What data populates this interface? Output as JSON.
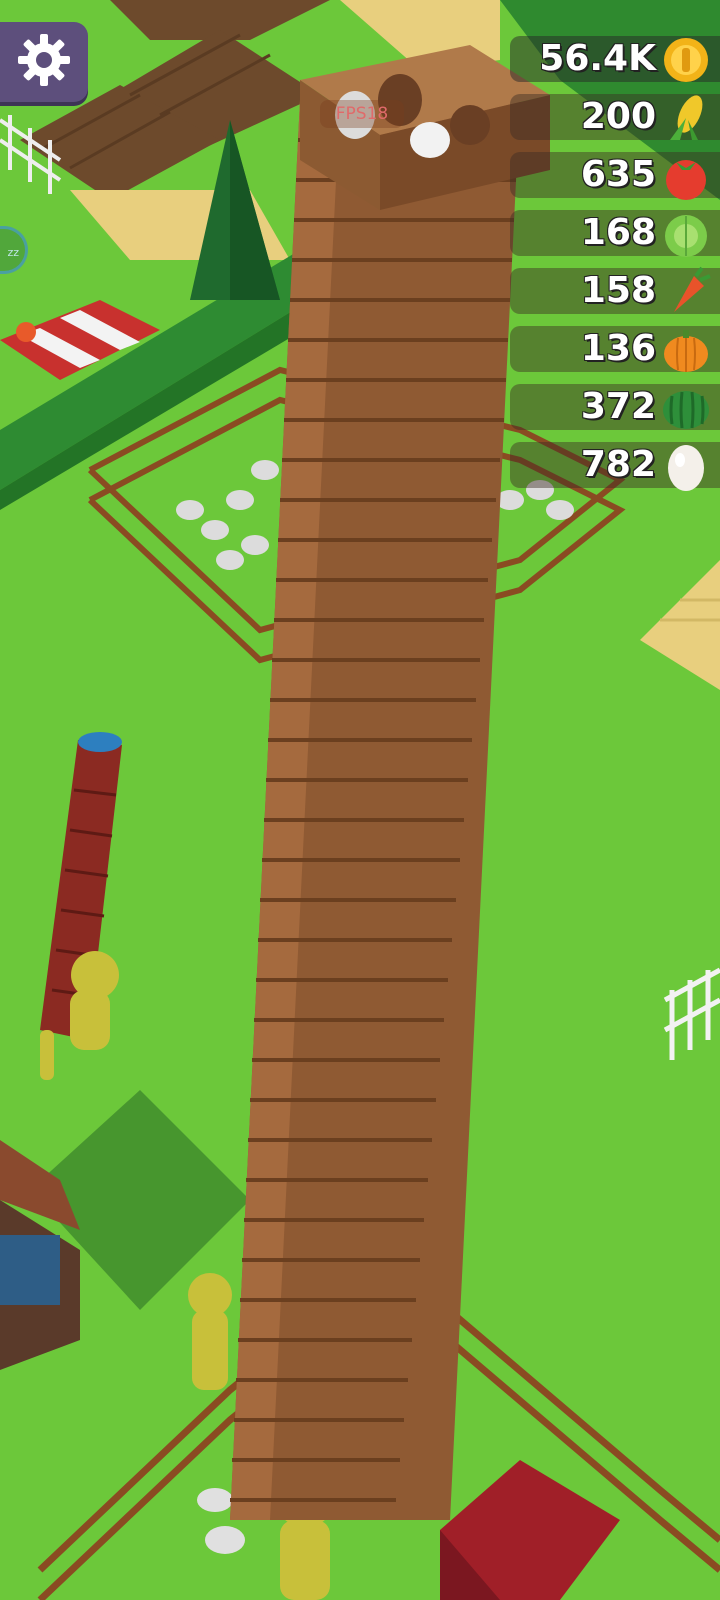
{
  "hud": {
    "fps": "FPS18",
    "side_badge": "zz"
  },
  "resources": [
    {
      "name": "coins",
      "value": "56.4K",
      "icon": "gold-coin-icon",
      "color": "#f2b318"
    },
    {
      "name": "corn",
      "value": "200",
      "icon": "corn-icon",
      "color": "#f0c82a"
    },
    {
      "name": "tomato",
      "value": "635",
      "icon": "tomato-icon",
      "color": "#e53c2e"
    },
    {
      "name": "cabbage",
      "value": "168",
      "icon": "cabbage-icon",
      "color": "#7ccc4a"
    },
    {
      "name": "carrot",
      "value": "158",
      "icon": "carrot-icon",
      "color": "#e8532a"
    },
    {
      "name": "pumpkin",
      "value": "136",
      "icon": "pumpkin-icon",
      "color": "#f08a1f"
    },
    {
      "name": "watermelon",
      "value": "372",
      "icon": "watermelon-icon",
      "color": "#2e8f3a"
    },
    {
      "name": "egg",
      "value": "782",
      "icon": "egg-icon",
      "color": "#f4f0ea"
    }
  ]
}
